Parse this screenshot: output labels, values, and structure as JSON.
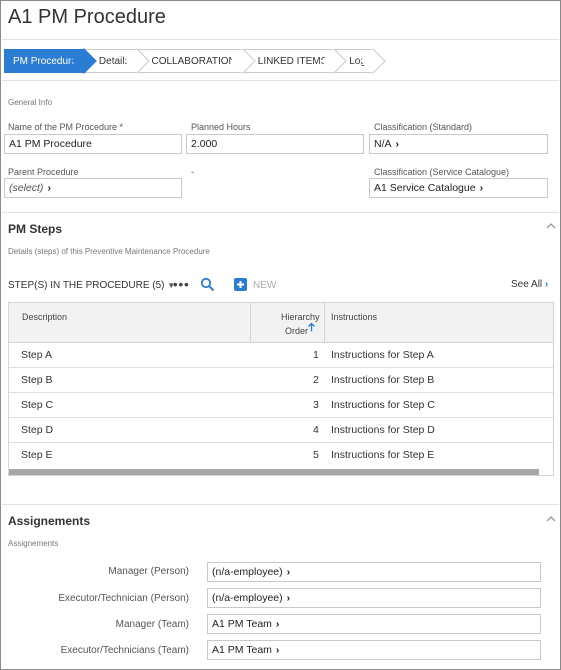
{
  "page": {
    "title": "A1 PM Procedure"
  },
  "tabs": [
    {
      "label": "PM Procedure",
      "active": true
    },
    {
      "label": "Details"
    },
    {
      "label": "COLLABORATION"
    },
    {
      "label": "LINKED ITEMS"
    },
    {
      "label": "Log"
    }
  ],
  "general": {
    "section_label": "General Info",
    "name_label": "Name of the PM Procedure *",
    "name_value": "A1 PM Procedure",
    "hours_label": "Planned Hours",
    "hours_value": "2.000",
    "class_std_label": "Classification (Standard)",
    "class_std_value": "N/A",
    "parent_label": "Parent Procedure",
    "parent_value": "(select)",
    "dash": "-",
    "class_svc_label": "Classification (Service Catalogue)",
    "class_svc_value": "A1 Service Catalogue"
  },
  "steps": {
    "title": "PM Steps",
    "subtitle": "Details (steps) of this Preventive Maintenance Procedure",
    "dropdown_label": "STEP(S) IN THE PROCEDURE (5)",
    "new_label": "NEW",
    "see_all": "See All",
    "headers": {
      "description": "Description",
      "hierarchy1": "Hierarchy",
      "hierarchy2": "Order",
      "instructions": "Instructions"
    },
    "rows": [
      {
        "description": "Step A",
        "order": "1",
        "instructions": "Instructions for Step A"
      },
      {
        "description": "Step B",
        "order": "2",
        "instructions": "Instructions for Step B"
      },
      {
        "description": "Step C",
        "order": "3",
        "instructions": "Instructions for Step C"
      },
      {
        "description": "Step D",
        "order": "4",
        "instructions": "Instructions for Step D"
      },
      {
        "description": "Step E",
        "order": "5",
        "instructions": "Instructions for Step E"
      }
    ]
  },
  "assign": {
    "title": "Assignements",
    "subtitle": "Assignements",
    "manager_person_label": "Manager (Person)",
    "manager_person_value": "(n/a-employee)",
    "exec_person_label": "Executor/Technician (Person)",
    "exec_person_value": "(n/a-employee)",
    "manager_team_label": "Manager (Team)",
    "manager_team_value": "A1 PM Team",
    "exec_team_label": "Executor/Technicians (Team)",
    "exec_team_value": "A1 PM Team"
  },
  "colors": {
    "accent": "#2b7cd3",
    "border": "#c9c9c9",
    "header_bg": "#f2f2f2"
  }
}
